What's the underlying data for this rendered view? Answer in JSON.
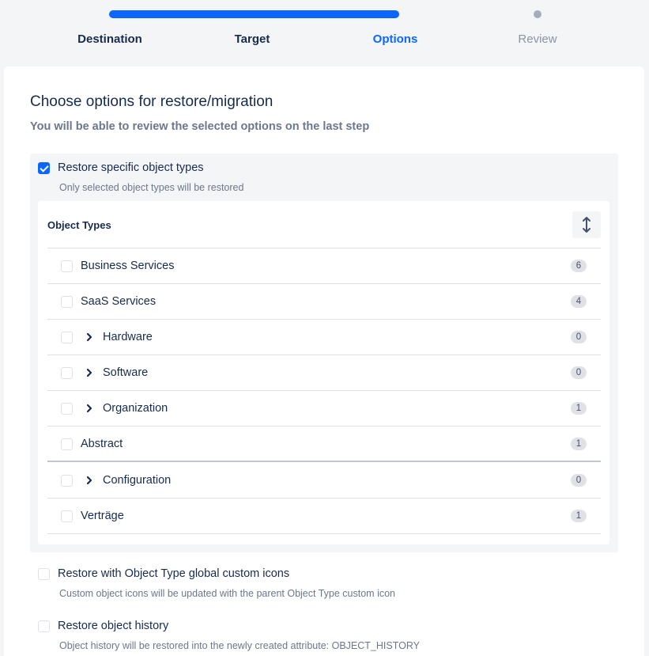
{
  "stepper": {
    "steps": [
      {
        "label": "Destination",
        "state": "done"
      },
      {
        "label": "Target",
        "state": "done"
      },
      {
        "label": "Options",
        "state": "current"
      },
      {
        "label": "Review",
        "state": "pending"
      }
    ],
    "accent_color": "#0b66ff"
  },
  "page": {
    "title": "Choose options for restore/migration",
    "subtitle": "You will be able to review the selected options on the last step"
  },
  "options": {
    "specific_types": {
      "label": "Restore specific object types",
      "help": "Only selected object types will be restored",
      "checked": true
    },
    "custom_icons": {
      "label": "Restore with Object Type global custom icons",
      "help": "Custom object icons will be updated with the parent Object Type custom icon",
      "checked": false
    },
    "history": {
      "label": "Restore object history",
      "help": "Object history will be restored into the newly created attribute: OBJECT_HISTORY",
      "checked": false
    }
  },
  "object_types": {
    "header": "Object Types",
    "sort_icon": "sort-vertical-icon",
    "rows": [
      {
        "name": "Business Services",
        "count": "6",
        "expandable": false,
        "checked": false
      },
      {
        "name": "SaaS Services",
        "count": "4",
        "expandable": false,
        "checked": false
      },
      {
        "name": "Hardware",
        "count": "0",
        "expandable": true,
        "checked": false
      },
      {
        "name": "Software",
        "count": "0",
        "expandable": true,
        "checked": false
      },
      {
        "name": "Organization",
        "count": "1",
        "expandable": true,
        "checked": false
      },
      {
        "name": "Abstract",
        "count": "1",
        "expandable": false,
        "checked": false
      },
      {
        "name": "Configuration",
        "count": "0",
        "expandable": true,
        "checked": false
      },
      {
        "name": "Verträge",
        "count": "1",
        "expandable": false,
        "checked": false
      }
    ]
  }
}
